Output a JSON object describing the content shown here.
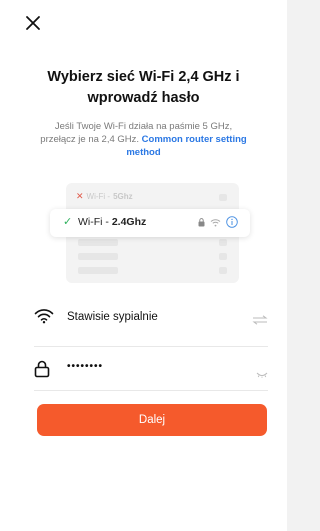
{
  "header": {
    "close_icon": "close-icon"
  },
  "title": {
    "line1": "Wybierz sieć Wi-Fi 2,4 GHz i",
    "line2": "wprowadź hasło"
  },
  "description": {
    "line1": "Jeśli Twoje Wi-Fi działa na paśmie 5 GHz,",
    "line2_text": "przełącz je na 2,4 GHz.",
    "link_part1": "Common router setting",
    "link_part2": "method",
    "link_color": "#2b78e4"
  },
  "illustration": {
    "wifi5": {
      "mark": "✕",
      "prefix": "Wi-Fi -",
      "band": "5Ghz"
    },
    "wifi24": {
      "mark": "✓",
      "prefix": "Wi-Fi -",
      "band": "2.4Ghz"
    }
  },
  "wifi_field": {
    "icon": "wifi-icon",
    "value": "Stawisie sypialnie",
    "switch_icon": "switch-network-icon"
  },
  "password_field": {
    "icon": "lock-icon",
    "value": "••••••••",
    "visibility_icon": "eye-closed-icon"
  },
  "primary_button": {
    "label": "Dalej",
    "color": "#f55a2c"
  }
}
